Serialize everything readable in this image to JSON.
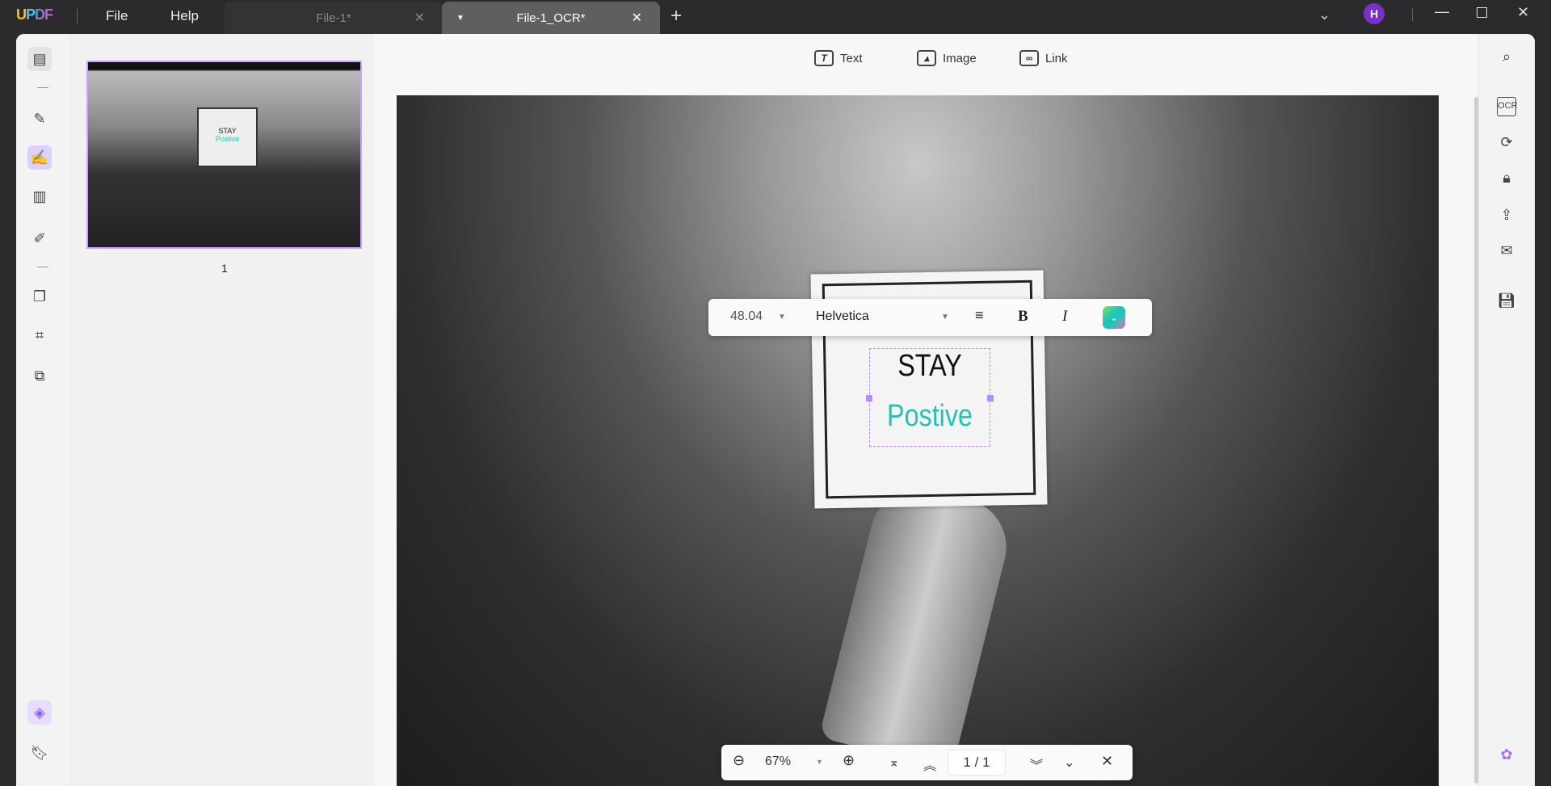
{
  "app": {
    "logo": "UPDF",
    "menu": [
      "File",
      "Help"
    ]
  },
  "tabs": [
    {
      "label": "File-1*",
      "active": false
    },
    {
      "label": "File-1_OCR*",
      "active": true
    }
  ],
  "user": {
    "avatar": "H",
    "avatar_color": "#7a2fc9"
  },
  "edit_tools": [
    "Text",
    "Image",
    "Link"
  ],
  "thumbnails": [
    {
      "page": "1"
    }
  ],
  "document": {
    "text_line1": "STAY",
    "text_line2": "Postive",
    "text_line2_color": "#22c4b8"
  },
  "format_toolbar": {
    "font_size": "48.04",
    "font": "Helvetica",
    "bold": "B",
    "italic": "I",
    "color": "#22c4b8"
  },
  "bottom_bar": {
    "zoom": "67%",
    "current_page": "1",
    "separator": "/",
    "total_pages": "1"
  },
  "accent": "#b58cff"
}
